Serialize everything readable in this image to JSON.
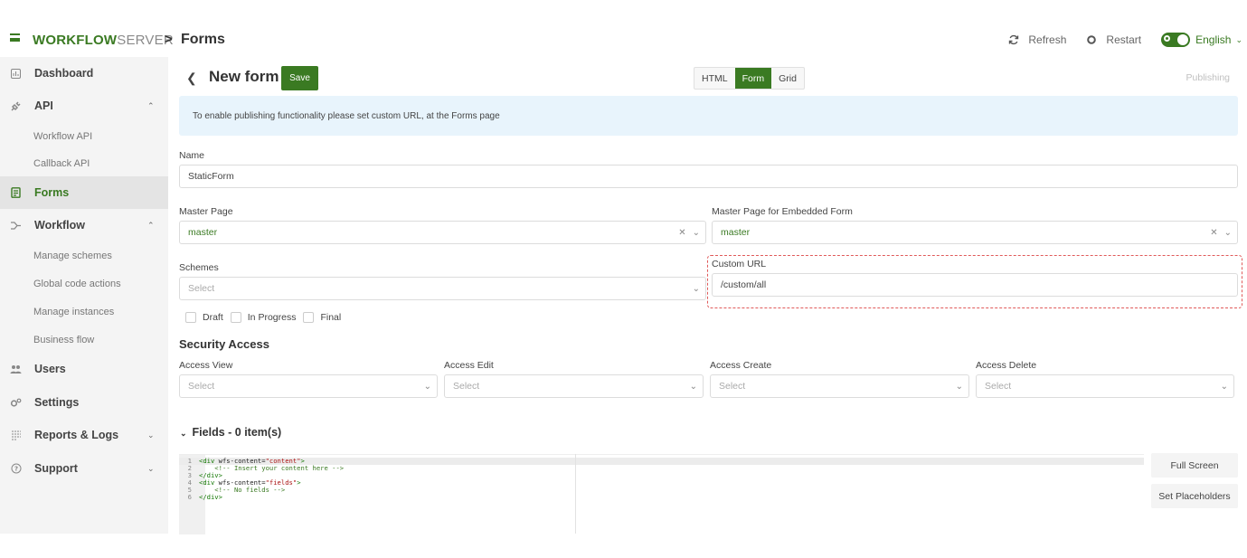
{
  "header": {
    "brand_strong": "WORKFLOW",
    "brand_light": "SERVER",
    "separator": ">",
    "breadcrumb": "Forms",
    "refresh_label": "Refresh",
    "restart_label": "Restart",
    "language": "English"
  },
  "sidebar": {
    "items": [
      {
        "label": "Dashboard",
        "icon": "dashboard-icon"
      },
      {
        "label": "API",
        "icon": "plug-icon",
        "expanded": true
      },
      {
        "label": "Forms",
        "icon": "forms-icon",
        "active": true
      },
      {
        "label": "Workflow",
        "icon": "workflow-icon",
        "expanded": true
      },
      {
        "label": "Users",
        "icon": "users-icon"
      },
      {
        "label": "Settings",
        "icon": "settings-icon"
      },
      {
        "label": "Reports & Logs",
        "icon": "reports-icon",
        "expanded": false
      },
      {
        "label": "Support",
        "icon": "support-icon",
        "expanded": false
      }
    ],
    "api_children": [
      "Workflow API",
      "Callback API"
    ],
    "workflow_children": [
      "Manage schemes",
      "Global code actions",
      "Manage instances",
      "Business flow"
    ]
  },
  "toolbar": {
    "title": "New form",
    "save_label": "Save",
    "view_tabs": [
      "HTML",
      "Form",
      "Grid"
    ],
    "active_view": "Form",
    "publishing_label": "Publishing"
  },
  "info_message": "To enable publishing functionality please set custom URL, at the Forms page",
  "form": {
    "name_label": "Name",
    "name_value": "StaticForm",
    "master_page_label": "Master Page",
    "master_page_value": "master",
    "master_embedded_label": "Master Page for Embedded Form",
    "master_embedded_value": "master",
    "schemes_label": "Schemes",
    "schemes_placeholder": "Select",
    "custom_url_label": "Custom URL",
    "custom_url_value": "/custom/all",
    "statuses": [
      "Draft",
      "In Progress",
      "Final"
    ]
  },
  "security": {
    "heading": "Security Access",
    "fields": [
      {
        "label": "Access View",
        "placeholder": "Select"
      },
      {
        "label": "Access Edit",
        "placeholder": "Select"
      },
      {
        "label": "Access Create",
        "placeholder": "Select"
      },
      {
        "label": "Access Delete",
        "placeholder": "Select"
      }
    ]
  },
  "fields_section": {
    "heading": "Fields - 0 item(s)",
    "code_lines": [
      {
        "n": "1",
        "parts": [
          [
            "tag",
            "<div "
          ],
          [
            "attr",
            "wfs-content="
          ],
          [
            "str",
            "\"content\""
          ],
          [
            "tag",
            ">"
          ]
        ]
      },
      {
        "n": "2",
        "parts": [
          [
            "cm",
            "    <!-- Insert your content here -->"
          ]
        ]
      },
      {
        "n": "3",
        "parts": [
          [
            "tag",
            "</div>"
          ]
        ]
      },
      {
        "n": "4",
        "parts": [
          [
            "tag",
            "<div "
          ],
          [
            "attr",
            "wfs-content="
          ],
          [
            "str",
            "\"fields\""
          ],
          [
            "tag",
            ">"
          ]
        ]
      },
      {
        "n": "5",
        "parts": [
          [
            "cm",
            "    <!-- No fields -->"
          ]
        ]
      },
      {
        "n": "6",
        "parts": [
          [
            "tag",
            "</div>"
          ]
        ]
      }
    ],
    "full_screen_label": "Full Screen",
    "set_placeholders_label": "Set Placeholders"
  },
  "colors": {
    "accent": "#3a7a22",
    "info_bg": "#e8f4fc",
    "highlight_dash": "#e05a5a"
  }
}
